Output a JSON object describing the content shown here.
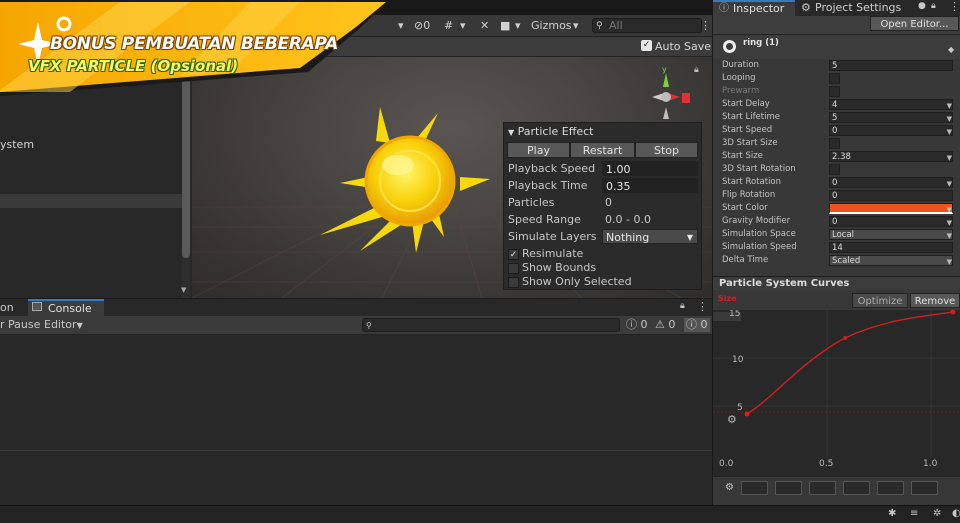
{
  "banner": {
    "line1": "BONUS PEMBUATAN BEBERAPA",
    "line2_a": "VFX PARTICLE",
    "line2_b": "(Opsional)"
  },
  "scene_toolbar": {
    "layers_count": "0",
    "gizmos_label": "Gizmos",
    "search_placeholder": "All",
    "auto_save_label": "Auto Save"
  },
  "hierarchy": {
    "items": [
      "ystem"
    ]
  },
  "particle_effect": {
    "title": "Particle Effect",
    "play": "Play",
    "restart": "Restart",
    "stop": "Stop",
    "playback_speed_label": "Playback Speed",
    "playback_speed": "1.00",
    "playback_time_label": "Playback Time",
    "playback_time": "0.35",
    "particles_label": "Particles",
    "particles": "0",
    "speed_range_label": "Speed Range",
    "speed_range": "0.0 - 0.0",
    "simulate_layers_label": "Simulate Layers",
    "simulate_layers": "Nothing",
    "resimulate": "Resimulate",
    "show_bounds": "Show Bounds",
    "show_only_selected": "Show Only Selected"
  },
  "console": {
    "tab_prev": "on",
    "tab_console": "Console",
    "pause_label": "r Pause",
    "editor_label": "Editor",
    "count_info": "0",
    "count_warn": "0",
    "count_error": "0"
  },
  "inspector": {
    "tab_inspector": "Inspector",
    "tab_project_settings": "Project Settings",
    "open_editor": "Open Editor...",
    "object_name": "ring (1)",
    "rows": [
      {
        "label": "Duration",
        "value": "5",
        "kind": "field"
      },
      {
        "label": "Looping",
        "value": "",
        "kind": "check"
      },
      {
        "label": "Prewarm",
        "value": "",
        "kind": "check",
        "dim": true
      },
      {
        "label": "Start Delay",
        "value": "4",
        "kind": "dropdown"
      },
      {
        "label": "Start Lifetime",
        "value": "5",
        "kind": "dropdown"
      },
      {
        "label": "Start Speed",
        "value": "0",
        "kind": "dropdown"
      },
      {
        "label": "3D Start Size",
        "value": "",
        "kind": "check"
      },
      {
        "label": "Start Size",
        "value": "2.38",
        "kind": "dropdown"
      },
      {
        "label": "3D Start Rotation",
        "value": "",
        "kind": "check"
      },
      {
        "label": "Start Rotation",
        "value": "0",
        "kind": "dropdown"
      },
      {
        "label": "Flip Rotation",
        "value": "0",
        "kind": "field"
      },
      {
        "label": "Start Color",
        "value": "",
        "kind": "color"
      },
      {
        "label": "Gravity Modifier",
        "value": "0",
        "kind": "dropdown"
      },
      {
        "label": "Simulation Space",
        "value": "Local",
        "kind": "dropdown"
      },
      {
        "label": "Simulation Speed",
        "value": "14",
        "kind": "field"
      },
      {
        "label": "Delta Time",
        "value": "Scaled",
        "kind": "dropdown"
      }
    ],
    "start_color": "#e8541e"
  },
  "curves": {
    "title": "Particle System Curves",
    "optimize": "Optimize",
    "remove": "Remove",
    "curve_label": "Size",
    "y_ticks": [
      "15",
      "10",
      "5"
    ],
    "x_ticks": [
      "0.0",
      "0.5",
      "1.0"
    ],
    "curve_color": "#d21f1f"
  }
}
